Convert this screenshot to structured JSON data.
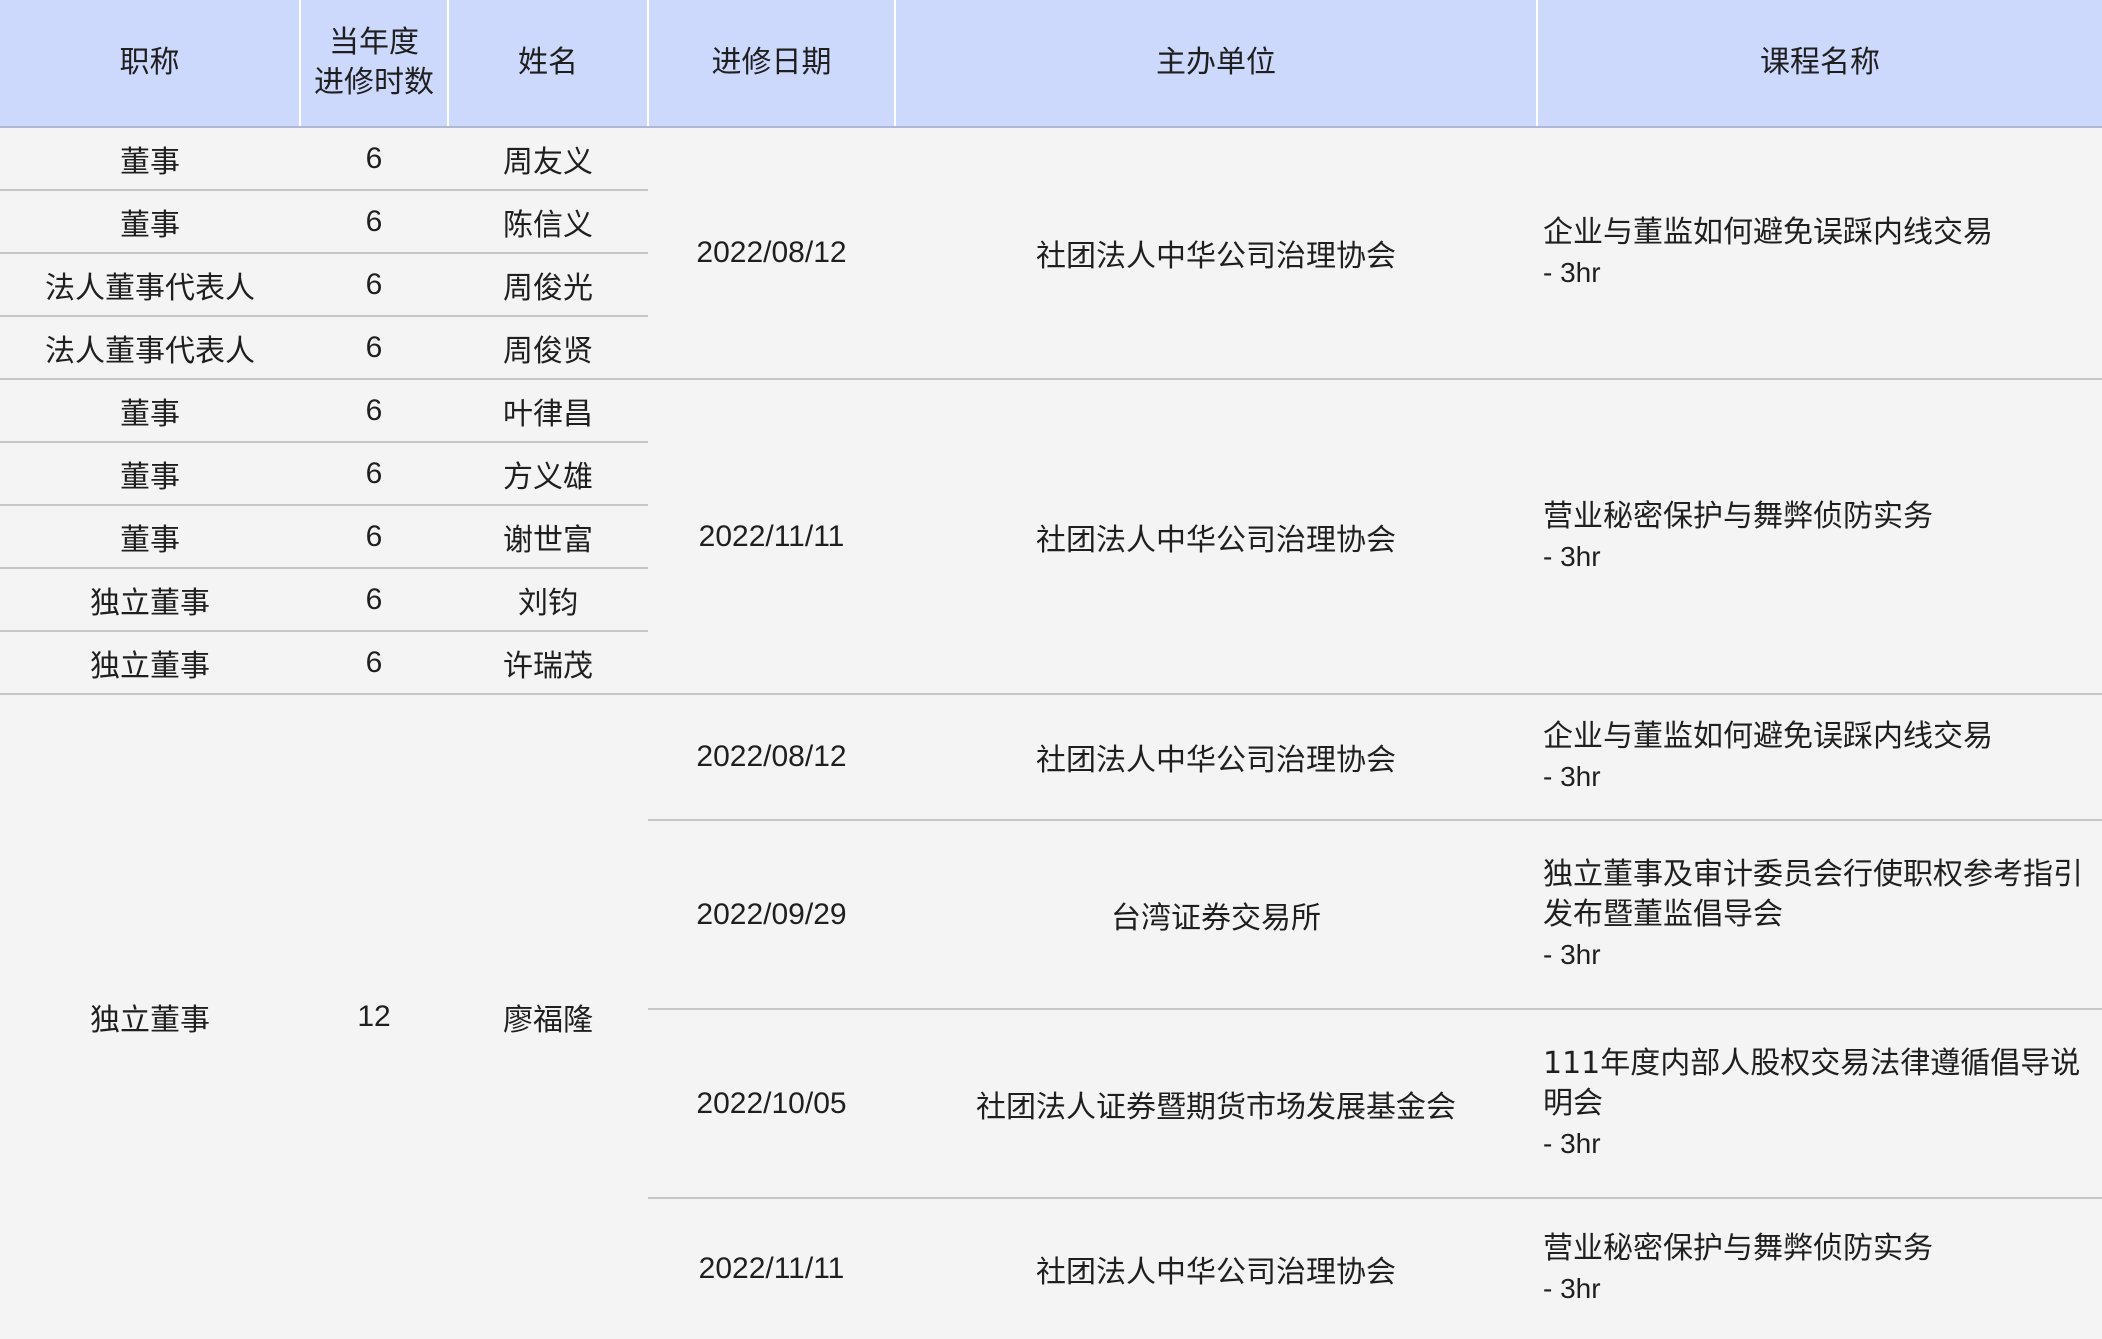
{
  "headers": {
    "title": "职称",
    "hours_line1": "当年度",
    "hours_line2": "进修时数",
    "name": "姓名",
    "date": "进修日期",
    "organizer": "主办单位",
    "course": "课程名称"
  },
  "group1": {
    "people": [
      {
        "title": "董事",
        "hours": "6",
        "name": "周友义"
      },
      {
        "title": "董事",
        "hours": "6",
        "name": "陈信义"
      },
      {
        "title": "法人董事代表人",
        "hours": "6",
        "name": "周俊光"
      },
      {
        "title": "法人董事代表人",
        "hours": "6",
        "name": "周俊贤"
      }
    ],
    "date": "2022/08/12",
    "organizer": "社团法人中华公司治理协会",
    "course": "企业与董监如何避免误踩内线交易",
    "hours_note": "- 3hr"
  },
  "group2": {
    "people": [
      {
        "title": "董事",
        "hours": "6",
        "name": "叶律昌"
      },
      {
        "title": "董事",
        "hours": "6",
        "name": "方义雄"
      },
      {
        "title": "董事",
        "hours": "6",
        "name": "谢世富"
      },
      {
        "title": "独立董事",
        "hours": "6",
        "name": "刘钧"
      },
      {
        "title": "独立董事",
        "hours": "6",
        "name": "许瑞茂"
      }
    ],
    "date": "2022/11/11",
    "organizer": "社团法人中华公司治理协会",
    "course": "营业秘密保护与舞弊侦防实务",
    "hours_note": "- 3hr"
  },
  "group3": {
    "title": "独立董事",
    "hours": "12",
    "name": "廖福隆",
    "sessions": [
      {
        "date": "2022/08/12",
        "organizer": "社团法人中华公司治理协会",
        "course": "企业与董监如何避免误踩内线交易",
        "hours_note": "- 3hr"
      },
      {
        "date": "2022/09/29",
        "organizer": "台湾证券交易所",
        "course": "独立董事及审计委员会行使职权参考指引发布暨董监倡导会",
        "hours_note": "- 3hr"
      },
      {
        "date": "2022/10/05",
        "organizer": "社团法人证券暨期货市场发展基金会",
        "course": "111年度内部人股权交易法律遵循倡导说明会",
        "hours_note": "- 3hr"
      },
      {
        "date": "2022/11/11",
        "organizer": "社团法人中华公司治理协会",
        "course": "营业秘密保护与舞弊侦防实务",
        "hours_note": "- 3hr"
      }
    ]
  }
}
